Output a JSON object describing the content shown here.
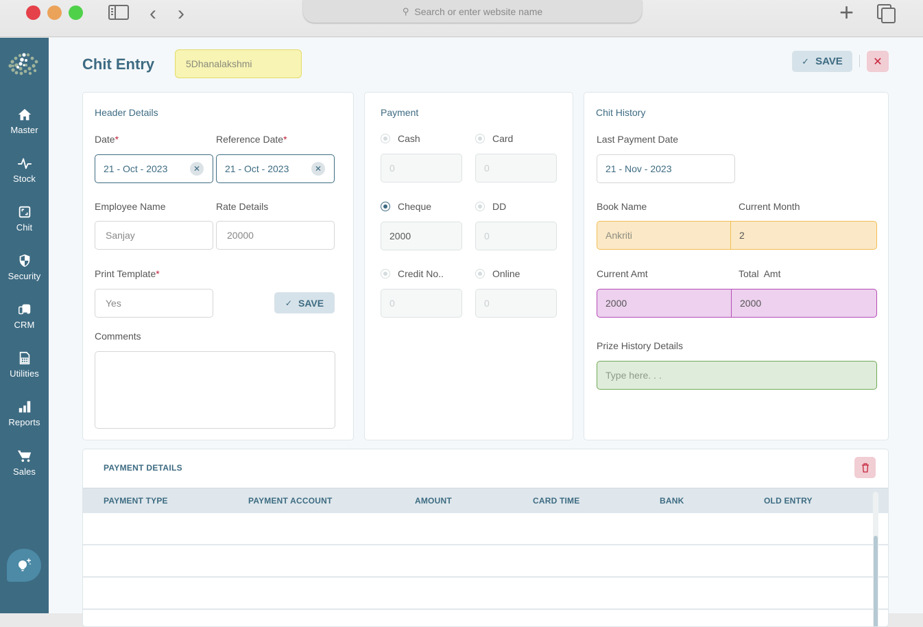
{
  "browser": {
    "address_placeholder": "Search or enter website name"
  },
  "sidebar": {
    "items": [
      {
        "label": "Master",
        "icon": "home-icon"
      },
      {
        "label": "Stock",
        "icon": "pulse-icon"
      },
      {
        "label": "Chit",
        "icon": "frame-icon"
      },
      {
        "label": "Security",
        "icon": "shield-icon"
      },
      {
        "label": "CRM",
        "icon": "crm-icon"
      },
      {
        "label": "Utilities",
        "icon": "spreadsheet-icon"
      },
      {
        "label": "Reports",
        "icon": "bar-chart-icon"
      },
      {
        "label": "Sales",
        "icon": "cart-icon"
      }
    ],
    "tip_icon": "lightbulb-icon"
  },
  "header": {
    "title": "Chit Entry",
    "customer_value": "5Dhanalakshmi",
    "save_label": "SAVE",
    "close_label": "✕"
  },
  "header_details": {
    "title": "Header Details",
    "date_label": "Date",
    "date_value": "21 - Oct - 2023",
    "ref_date_label": "Reference Date",
    "ref_date_value": "21 - Oct - 2023",
    "employee_label": "Employee Name",
    "employee_placeholder": "Sanjay",
    "rate_label": "Rate Details",
    "rate_placeholder": "20000",
    "print_label": "Print Template",
    "print_placeholder": "Yes",
    "save_label": "SAVE",
    "comments_label": "Comments",
    "comments_value": "",
    "required_mark": "*"
  },
  "payment": {
    "title": "Payment",
    "options": [
      {
        "label": "Cash",
        "value": "0",
        "selected": false
      },
      {
        "label": "Card",
        "value": "0",
        "selected": false
      },
      {
        "label": "Cheque",
        "value": "2000",
        "selected": true
      },
      {
        "label": "DD",
        "value": "0",
        "selected": false
      },
      {
        "label": "Credit No..",
        "value": "0",
        "selected": false
      },
      {
        "label": "Online",
        "value": "0",
        "selected": false
      }
    ]
  },
  "chit_history": {
    "title": "Chit History",
    "last_payment_label": "Last Payment Date",
    "last_payment_value": "21 - Nov - 2023",
    "book_name_label": "Book Name",
    "book_name_value": "Ankriti",
    "current_month_label": "Current Month",
    "current_month_value": "2",
    "current_amt_label": "Current Amt",
    "current_amt_value": "2000",
    "total_amt_label": "Total  Amt",
    "total_amt_value": "2000",
    "prize_label": "Prize History Details",
    "prize_placeholder": "Type here. . ."
  },
  "payment_details": {
    "title": "PAYMENT DETAILS",
    "columns": [
      "PAYMENT TYPE",
      "PAYMENT ACCOUNT",
      "AMOUNT",
      "CARD TIME",
      "BANK",
      "OLD ENTRY"
    ],
    "rows": []
  },
  "colors": {
    "primary": "#3d6b82",
    "danger": "#c7233b",
    "customer_bg": "#f7f4b4",
    "book_bg": "#fbe8c6",
    "amount_bg": "#edd1ee",
    "prize_bg": "#e0ecdb"
  }
}
